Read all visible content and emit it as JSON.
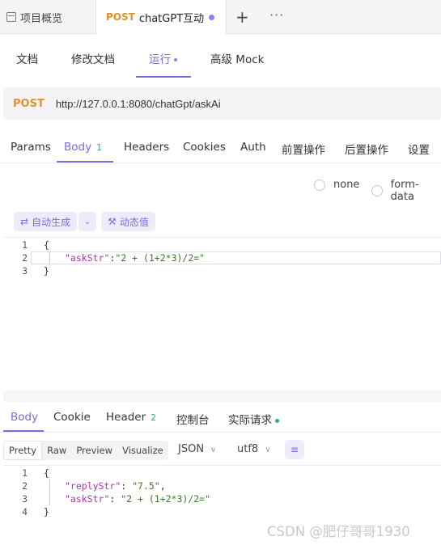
{
  "tabs": {
    "overview_label": "项目概览",
    "active_method": "POST",
    "active_title": "chatGPT互动",
    "plus": "+",
    "more": "···"
  },
  "subtabs": [
    "文档",
    "修改文档",
    "运行",
    "高级 Mock"
  ],
  "request": {
    "method": "POST",
    "url": "http://127.0.0.1:8080/chatGpt/askAi"
  },
  "request_tabs": {
    "params": "Params",
    "body": "Body",
    "body_count": "1",
    "headers": "Headers",
    "cookies": "Cookies",
    "auth": "Auth",
    "pre": "前置操作",
    "post": "后置操作",
    "settings": "设置"
  },
  "body_types": {
    "none": "none",
    "form_data": "form-data"
  },
  "toolbar": {
    "auto_generate": "自动生成",
    "dynamic_value": "动态值"
  },
  "request_body": {
    "line_numbers": [
      "1",
      "2",
      "3"
    ],
    "open": "{",
    "key": "\"askStr\"",
    "colon": ":",
    "value": "\"2 + (1+2*3)/2=\"",
    "close": "}"
  },
  "response_tabs": {
    "body": "Body",
    "cookie": "Cookie",
    "header": "Header",
    "header_count": "2",
    "console": "控制台",
    "actual_request": "实际请求"
  },
  "response_toolbar": {
    "formats": [
      "Pretty",
      "Raw",
      "Preview",
      "Visualize"
    ],
    "type": "JSON",
    "encoding": "utf8"
  },
  "response_body": {
    "line_numbers": [
      "1",
      "2",
      "3",
      "4"
    ],
    "open": "{",
    "key1": "\"replyStr\"",
    "val1": "\"7.5\"",
    "key2": "\"askStr\"",
    "val2": "\"2 + (1+2*3)/2=\"",
    "close": "}"
  },
  "watermark": "CSDN @肥仔哥哥1930",
  "colors": {
    "accent": "#7b6be0",
    "method": "#e0912b",
    "success": "#3cab6c"
  }
}
